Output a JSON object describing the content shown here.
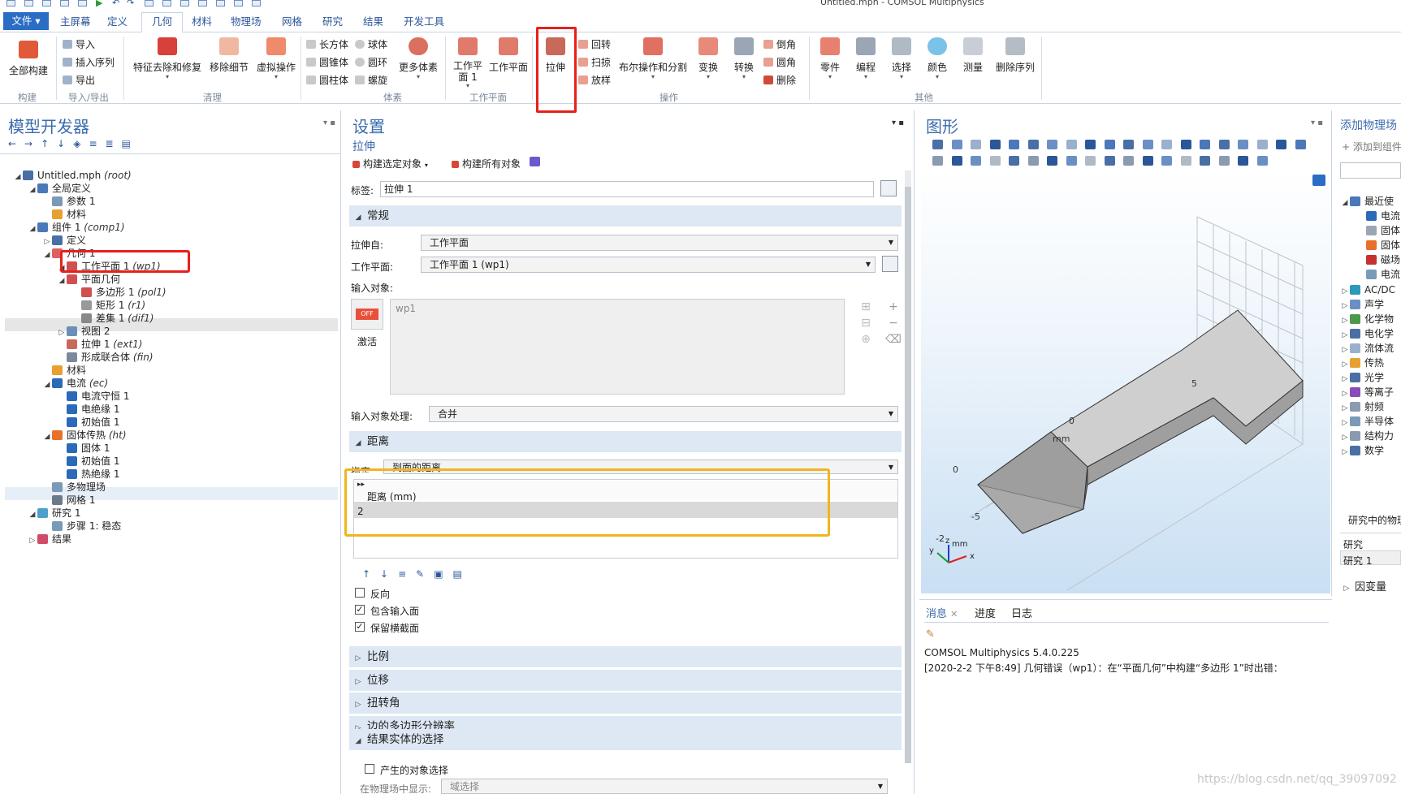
{
  "window": {
    "title": "Untitled.mph - COMSOL Multiphysics"
  },
  "menu": {
    "file": "文件 ▾",
    "tabs": [
      "主屏幕",
      "定义",
      "几何",
      "材料",
      "物理场",
      "网格",
      "研究",
      "结果",
      "开发工具"
    ],
    "active": "几何"
  },
  "ribbon": {
    "groups": {
      "build": "构建",
      "import_export": "导入/导出",
      "cleanup": "清理",
      "solids": "体素",
      "workplane": "工作平面",
      "operations": "操作",
      "other": "其他"
    },
    "build_all": "全部构建",
    "import": "导入",
    "insert_sequence": "插入序列",
    "export": "导出",
    "defeaturing": "特征去除和修复",
    "remove_details": "移除细节",
    "virtual_ops": "虚拟操作",
    "block": "长方体",
    "sphere": "球体",
    "cone": "圆锥体",
    "torus": "圆环",
    "cylinder": "圆柱体",
    "helix": "螺旋",
    "more_primitives": "更多体素",
    "work_plane_1": "工作平面 1",
    "work_plane": "工作平面",
    "extrude": "拉伸",
    "revolve": "回转",
    "sweep": "扫掠",
    "loft": "放样",
    "boolean_partition": "布尔操作和分割",
    "transforms": "变换",
    "conversions": "转换",
    "chamfer": "倒角",
    "fillet": "圆角",
    "delete": "删除",
    "parts": "零件",
    "programming": "编程",
    "selections": "选择",
    "colors": "颜色",
    "measure": "测量",
    "delete_sequence": "删除序列"
  },
  "model_builder": {
    "title": "模型开发器",
    "tree": [
      {
        "label": "Untitled.mph",
        "tag": "(root)"
      },
      {
        "label": "全局定义",
        "tag": ""
      },
      {
        "label": "参数 1",
        "tag": ""
      },
      {
        "label": "材料",
        "tag": ""
      },
      {
        "label": "组件 1",
        "tag": "(comp1)"
      },
      {
        "label": "定义",
        "tag": ""
      },
      {
        "label": "几何 1",
        "tag": ""
      },
      {
        "label": "工作平面 1",
        "tag": "(wp1)"
      },
      {
        "label": "平面几何",
        "tag": ""
      },
      {
        "label": "多边形 1",
        "tag": "(pol1)"
      },
      {
        "label": "矩形 1",
        "tag": "(r1)"
      },
      {
        "label": "差集 1",
        "tag": "(dif1)"
      },
      {
        "label": "视图 2",
        "tag": ""
      },
      {
        "label": "拉伸 1",
        "tag": "(ext1)"
      },
      {
        "label": "形成联合体",
        "tag": "(fin)"
      },
      {
        "label": "材料",
        "tag": ""
      },
      {
        "label": "电流",
        "tag": "(ec)"
      },
      {
        "label": "电流守恒 1",
        "tag": ""
      },
      {
        "label": "电绝缘 1",
        "tag": ""
      },
      {
        "label": "初始值 1",
        "tag": ""
      },
      {
        "label": "固体传热",
        "tag": "(ht)"
      },
      {
        "label": "固体 1",
        "tag": ""
      },
      {
        "label": "初始值 1",
        "tag": ""
      },
      {
        "label": "热绝缘 1",
        "tag": ""
      },
      {
        "label": "多物理场",
        "tag": ""
      },
      {
        "label": "网格 1",
        "tag": ""
      },
      {
        "label": "研究 1",
        "tag": ""
      },
      {
        "label": "步骤 1: 稳态",
        "tag": ""
      },
      {
        "label": "结果",
        "tag": ""
      }
    ]
  },
  "settings": {
    "title": "设置",
    "subtitle": "拉伸",
    "build_selected": "构建选定对象",
    "build_all": "构建所有对象",
    "label_caption": "标签:",
    "label_value": "拉伸 1",
    "general": {
      "header": "常规",
      "extrude_from_label": "拉伸自:",
      "extrude_from": "工作平面",
      "work_plane_label": "工作平面:",
      "work_plane": "工作平面 1 (wp1)",
      "input_objects_label": "输入对象:",
      "input_object": "wp1",
      "activate": "激活",
      "toggle_state": "OFF",
      "handling_label": "输入对象处理:",
      "handling": "合并"
    },
    "distance": {
      "header": "距离",
      "specify_label": "指定:",
      "specify": "到面的距离",
      "column_header": "距离 (mm)",
      "value": "2"
    },
    "reverse": "反向",
    "include_input": "包含输入面",
    "keep_cross": "保留横截面",
    "sections": [
      "比例",
      "位移",
      "扭转角",
      "边的多边形分辨率"
    ],
    "result_selection": {
      "header": "结果实体的选择",
      "resulting": "产生的对象选择",
      "show_in_physics_label": "在物理场中显示:",
      "show_in_physics": "域选择"
    }
  },
  "graphics": {
    "title": "图形",
    "axis_unit": "mm",
    "tick_labels": [
      "5",
      "0",
      "-5",
      "-2",
      "0"
    ],
    "axes": {
      "x": "x",
      "y": "y",
      "z": "z"
    },
    "unit_label": "mm"
  },
  "messages": {
    "tabs": [
      "消息",
      "进度",
      "日志"
    ],
    "lines": [
      "COMSOL Multiphysics 5.4.0.225",
      "[2020-2-2 下午8:49] 几何错误（wp1）：在“平面几何”中构建“多边形 1”时出错："
    ]
  },
  "add_physics": {
    "title": "添加物理场",
    "add_to": "添加到组件",
    "items": [
      "最近使",
      "电流",
      "固体",
      "固体",
      "磁场",
      "电流",
      "AC/DC",
      "声学",
      "化学物",
      "电化学",
      "流体流",
      "传热",
      "光学",
      "等离子",
      "射频",
      "半导体",
      "结构力",
      "数学"
    ],
    "study_physics": "研究中的物理",
    "study_label": "研究",
    "study_value": "研究 1",
    "dependent_vars": "因变量"
  },
  "watermark": "https://blog.csdn.net/qq_39097092"
}
